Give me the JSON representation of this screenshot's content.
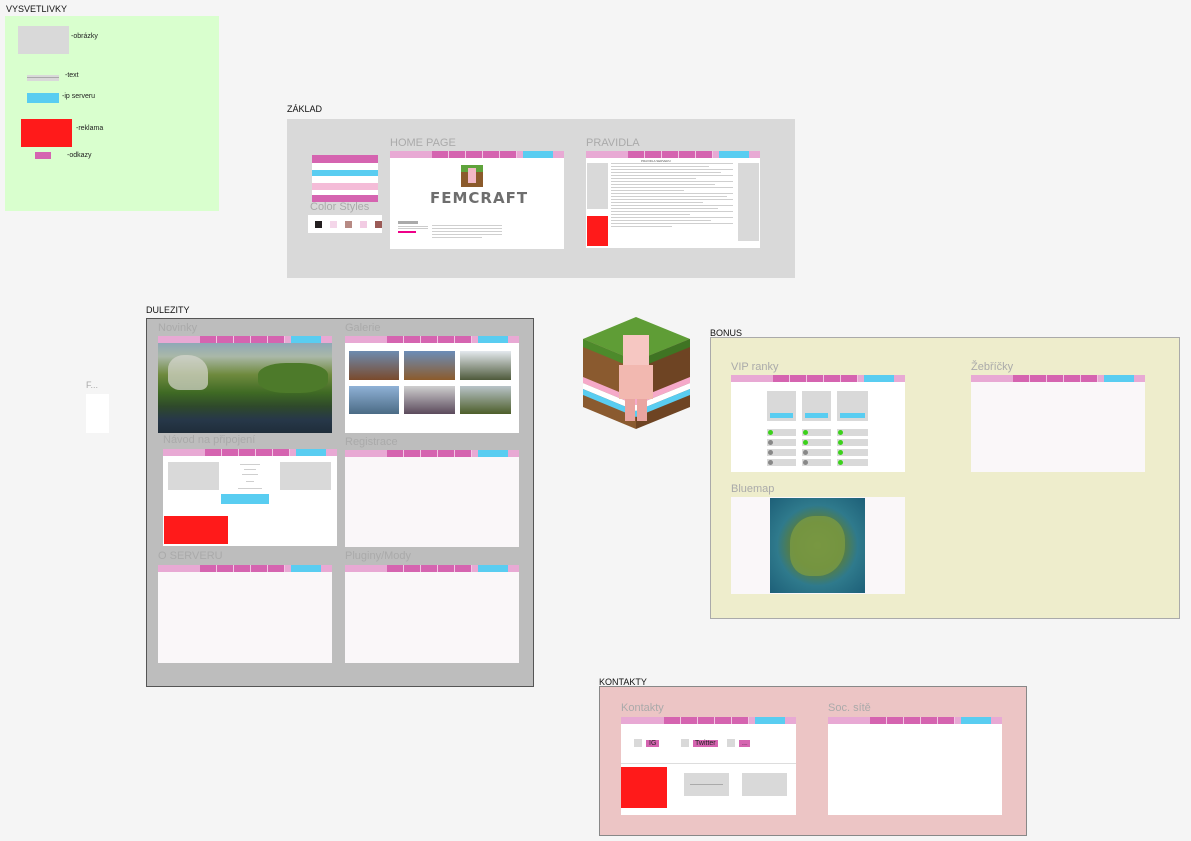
{
  "legend": {
    "title": "VYSVETLIVKY",
    "items": [
      "-obrázky",
      "-text",
      "-ip serveru",
      "-reklama",
      "-odkazy"
    ]
  },
  "zaklad": {
    "title": "ZÁKLAD",
    "color_styles": "Color Styles",
    "swatches": [
      "#231f20",
      "#f4d6e9",
      "#b78a84",
      "#f2cbe3",
      "#9b5b57"
    ],
    "home_page": "HOME PAGE",
    "logo_text": "FEMCRAFT",
    "pravidla": "PRAVIDLA",
    "pravidla_heading": "PRAVIDLA SERVERU"
  },
  "dulezity": {
    "title": "DULEZITY",
    "novinky": "Novinky",
    "galerie": "Galerie",
    "navod": "Návod na připojení",
    "registrace": "Registrace",
    "o_serveru": "O SERVERU",
    "pluginy": "Pluginy/Mody"
  },
  "f_frame": "F...",
  "bonus": {
    "title": "BONUS",
    "vip": "VIP ranky",
    "zebricky": "Žebříčky",
    "bluemap": "Bluemap"
  },
  "kontakty": {
    "title": "KONTAKTY",
    "kontakty": "Kontakty",
    "soc": "Soc. sítě",
    "links": [
      "IG",
      "Twitter",
      "----"
    ]
  },
  "colors": {
    "pink_light": "#e8a9d4",
    "pink_dark": "#d564b0",
    "ip_blue": "#59cdf1",
    "ad_red": "#ff1a1a",
    "legend_bg": "#d9ffce",
    "bonus_bg": "#eeedcc",
    "kontakty_bg": "#ecc5c5"
  }
}
